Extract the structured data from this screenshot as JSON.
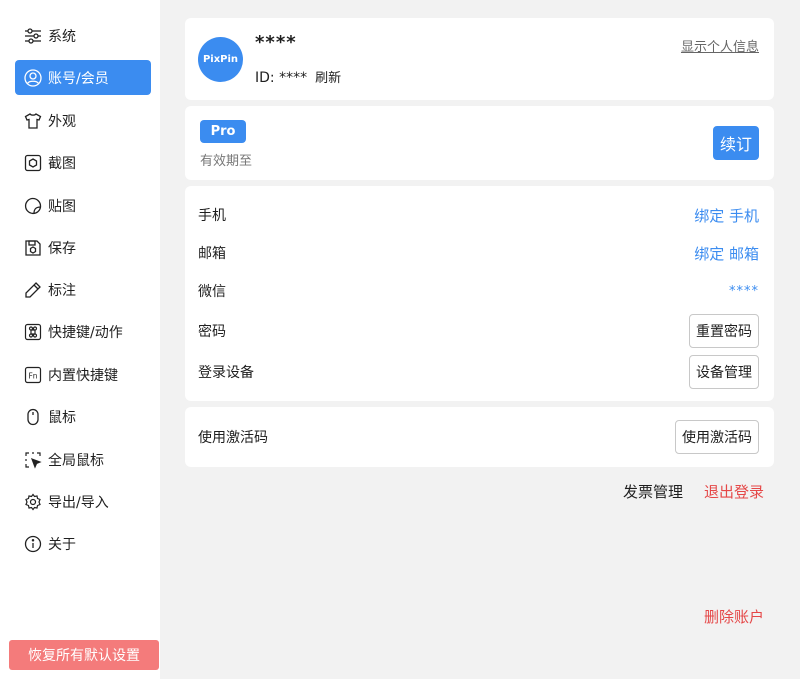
{
  "sidebar": {
    "items": [
      {
        "label": "系统",
        "icon": "sliders-icon"
      },
      {
        "label": "账号/会员",
        "icon": "user-circle-icon"
      },
      {
        "label": "外观",
        "icon": "tshirt-icon"
      },
      {
        "label": "截图",
        "icon": "screenshot-icon"
      },
      {
        "label": "贴图",
        "icon": "sticker-icon"
      },
      {
        "label": "保存",
        "icon": "save-icon"
      },
      {
        "label": "标注",
        "icon": "pencil-icon"
      },
      {
        "label": "快捷键/动作",
        "icon": "command-key-icon"
      },
      {
        "label": "内置快捷键",
        "icon": "fn-key-icon"
      },
      {
        "label": "鼠标",
        "icon": "mouse-icon"
      },
      {
        "label": "全局鼠标",
        "icon": "cursor-select-icon"
      },
      {
        "label": "导出/导入",
        "icon": "gear-icon"
      },
      {
        "label": "关于",
        "icon": "info-icon"
      }
    ],
    "active_index": 1,
    "reset_label": "恢复所有默认设置"
  },
  "profile": {
    "avatar_text": "PixPin",
    "username": "****",
    "id_label": "ID: ****",
    "refresh_label": "刷新",
    "show_info_label": "显示个人信息"
  },
  "plan": {
    "badge": "Pro",
    "expire_label": "有效期至",
    "renew_label": "续订"
  },
  "bindings": {
    "phone": {
      "label": "手机",
      "action": "绑定 手机"
    },
    "email": {
      "label": "邮箱",
      "action": "绑定 邮箱"
    },
    "wechat": {
      "label": "微信",
      "value": "****"
    },
    "password": {
      "label": "密码",
      "action": "重置密码"
    },
    "devices": {
      "label": "登录设备",
      "action": "设备管理"
    }
  },
  "activation": {
    "label": "使用激活码",
    "button": "使用激活码"
  },
  "footer": {
    "invoice": "发票管理",
    "logout": "退出登录",
    "delete": "删除账户"
  },
  "colors": {
    "accent": "#3b8cf0",
    "danger": "#e54848",
    "reset_button": "#f47b7b"
  }
}
